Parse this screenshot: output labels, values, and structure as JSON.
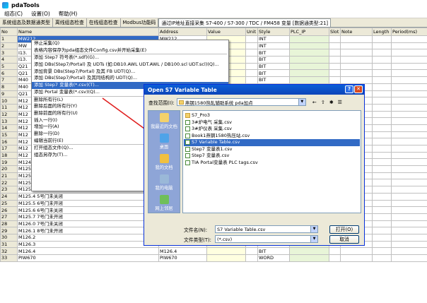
{
  "app": {
    "title": "pdaTools"
  },
  "menu": [
    "组态(C)",
    "设置(O)",
    "帮助(H)"
  ],
  "tabs": [
    "系统组态及数据通类型",
    "离线组态检查",
    "在线组态检查",
    "Modbus功能码",
    "通过IP地址直接采集 S7-400 / S7-300 / TDC / FM458 变量 [数据通类型:21]"
  ],
  "columns": [
    "No",
    "Name",
    "Address",
    "Value",
    "Unit",
    "Style",
    "PLC_IP",
    "Slot",
    "Note",
    "Length",
    "Period(ms)"
  ],
  "rows": [
    {
      "no": "1",
      "name": "MW212",
      "addr": "MW212",
      "style": "INT"
    },
    {
      "no": "2",
      "name": "MW",
      "addr": "",
      "style": "INT"
    },
    {
      "no": "3",
      "name": "I13.",
      "addr": "",
      "style": "BIT"
    },
    {
      "no": "4",
      "name": "I13.",
      "addr": "",
      "style": "BIT"
    },
    {
      "no": "5",
      "name": "Q21",
      "addr": "",
      "style": "BIT"
    },
    {
      "no": "6",
      "name": "Q21",
      "addr": "",
      "style": "BIT"
    },
    {
      "no": "7",
      "name": "M40",
      "addr": "",
      "style": "BIT"
    },
    {
      "no": "8",
      "name": "M40",
      "addr": "",
      "style": "BIT"
    },
    {
      "no": "9",
      "name": "Q21",
      "addr": "",
      "style": "BIT"
    },
    {
      "no": "10",
      "name": "M12",
      "addr": "",
      "style": "BIT"
    },
    {
      "no": "11",
      "name": "M12",
      "addr": "",
      "style": "BIT"
    },
    {
      "no": "12",
      "name": "M12",
      "addr": "",
      "style": "BIT"
    },
    {
      "no": "13",
      "name": "M12",
      "addr": "",
      "style": "BIT"
    },
    {
      "no": "14",
      "name": "M12",
      "addr": "",
      "style": "BIT"
    },
    {
      "no": "15",
      "name": "M12",
      "addr": "",
      "style": "BIT"
    },
    {
      "no": "16",
      "name": "M12",
      "addr": "",
      "style": "BIT"
    },
    {
      "no": "17",
      "name": "M12",
      "addr": "",
      "style": "BIT"
    },
    {
      "no": "18",
      "name": "M12",
      "addr": "",
      "style": "BIT"
    },
    {
      "no": "19",
      "name": "M124.7 3号门未开闭",
      "addr": "",
      "style": "BIT"
    },
    {
      "no": "20",
      "name": "M125.0 3号门未关闭",
      "addr": "",
      "style": "BIT"
    },
    {
      "no": "21",
      "name": "M125.1 4号门未开闭",
      "addr": "",
      "style": "BIT"
    },
    {
      "no": "22",
      "name": "M125.2 4号门未关闭",
      "addr": "",
      "style": "BIT"
    },
    {
      "no": "23",
      "name": "M125.3 5号门未开闭",
      "addr": "",
      "style": "BIT"
    },
    {
      "no": "24",
      "name": "M125.4 5号门未关闭",
      "addr": "",
      "style": "BIT"
    },
    {
      "no": "25",
      "name": "M125.5 6号门未开闭",
      "addr": "",
      "style": "BIT"
    },
    {
      "no": "26",
      "name": "M125.6 6号门未关闭",
      "addr": "",
      "style": "BIT"
    },
    {
      "no": "27",
      "name": "M125.7 7号门未开闭",
      "addr": "",
      "style": "BIT"
    },
    {
      "no": "28",
      "name": "M126.0 7号门未关闭",
      "addr": "M126.0",
      "style": "BIT"
    },
    {
      "no": "29",
      "name": "M126.1 8号门未开闭",
      "addr": "M126.1",
      "style": "BIT"
    },
    {
      "no": "30",
      "name": "M126.2",
      "addr": "M126.2",
      "style": "BIT"
    },
    {
      "no": "31",
      "name": "M126.3",
      "addr": "M126.3",
      "style": "BIT"
    },
    {
      "no": "32",
      "name": "M126.4",
      "addr": "M126.4",
      "style": "BIT"
    },
    {
      "no": "33",
      "name": "PIW670",
      "addr": "PIW670",
      "style": "WORD"
    }
  ],
  "context_menu": [
    {
      "label": "停止采集(Q)"
    },
    {
      "label": "表格内容保存为pda组态文件Config.csv并开始采集(E)"
    },
    {
      "sep": true
    },
    {
      "label": "添加 Step7 符号表(*.sdf)(G)..."
    },
    {
      "label": "添加 DBs(Step7/Portal) 及 UDTs (如:DB10.AWL UDT.AWL / DB100.scl UDT.scl)(Q)..."
    },
    {
      "label": "添加背景 DBs(Step7/Portal) 及其 FB UDT(Q)..."
    },
    {
      "label": "添加 DBs(Step7/Portal) 及其同结构的 UDT(Q)..."
    },
    {
      "label": "添加 Step7 变量表(*.csv)(T)...",
      "highlight": true
    },
    {
      "label": "添加 Portal 变量表(*.csv)(Q)..."
    },
    {
      "sep": true
    },
    {
      "label": "删除所有行(L)"
    },
    {
      "label": "删除后面的所有行(Y)"
    },
    {
      "label": "删除前面的所有行(U)"
    },
    {
      "label": "插入一行(I)"
    },
    {
      "label": "增加一行(A)"
    },
    {
      "label": "删除一行(D)"
    },
    {
      "label": "编辑当前行(E)"
    },
    {
      "sep": true
    },
    {
      "label": "打开组态文件(Q)..."
    },
    {
      "label": "组态另存为(T)..."
    }
  ],
  "dialog": {
    "title": "Open S7 Variable Table",
    "look_in_label": "查找范围(I):",
    "look_in_value": "燕钢1580热轧辅助系统 pda加点",
    "places": [
      "我最近的文档",
      "桌面",
      "我的文档",
      "我的电脑",
      "网上邻居"
    ],
    "files": [
      {
        "name": "S7_Pro3",
        "type": "folder"
      },
      {
        "name": "3#炉电气 采集.csv",
        "type": "csv"
      },
      {
        "name": "3#炉仪表 采集.csv",
        "type": "csv"
      },
      {
        "name": "Book1燕钢1580热压站.csv",
        "type": "csv"
      },
      {
        "name": "S7 Variable Table.csv",
        "type": "csv",
        "selected": true
      },
      {
        "name": "Step7 变量表1.csv",
        "type": "csv"
      },
      {
        "name": "Step7 变量表.csv",
        "type": "csv"
      },
      {
        "name": "TIA Portal变量表 PLC tags.csv",
        "type": "csv"
      }
    ],
    "filename_label": "文件名(N):",
    "filename_value": "S7 Variable Table.csv",
    "filetype_label": "文件类型(T):",
    "filetype_value": "(*.csv)",
    "open_label": "打开(O)",
    "cancel_label": "取消"
  },
  "colors": {
    "selection": "#316ac5",
    "arrow": "#e02020",
    "dialog_title": "#0a5fd8"
  }
}
